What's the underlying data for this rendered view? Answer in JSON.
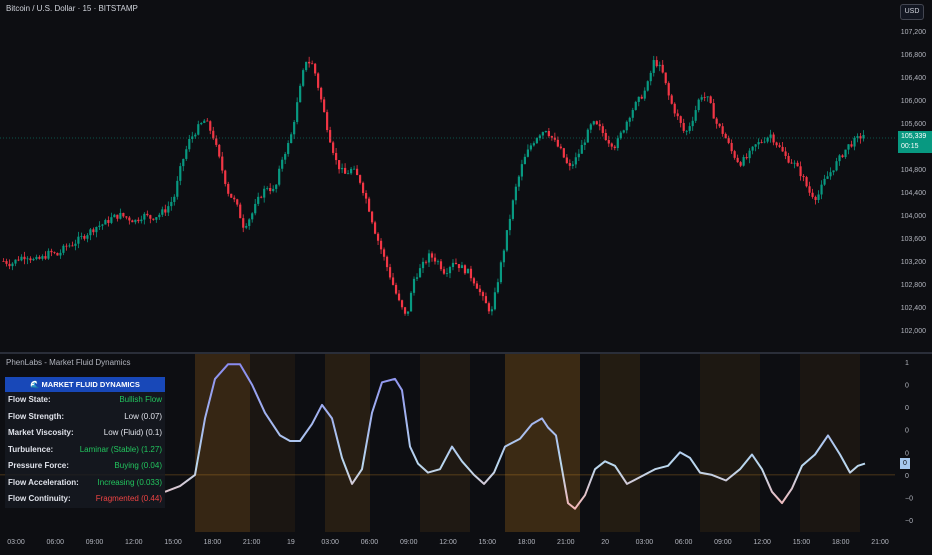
{
  "header": {
    "symbol_title": "Bitcoin / U.S. Dollar · 15 · BITSTAMP",
    "currency": "USD"
  },
  "price_axis": {
    "ticks": [
      "107,200",
      "106,800",
      "106,400",
      "106,000",
      "105,600",
      "104,800",
      "104,400",
      "104,000",
      "103,600",
      "103,200",
      "102,800",
      "102,400",
      "102,000"
    ],
    "tick_values": [
      107200,
      106800,
      106400,
      106000,
      105600,
      104800,
      104400,
      104000,
      103600,
      103200,
      102800,
      102400,
      102000
    ],
    "current_price": "105,339",
    "current_price_value": 105339,
    "countdown": "00:15"
  },
  "indicator": {
    "title": "PhenLabs - Market Fluid Dynamics",
    "axis_ticks": [
      "1",
      "0",
      "0",
      "0",
      "0",
      "0",
      "−0",
      "−0"
    ],
    "axis_tick_values": [
      1,
      0.8,
      0.6,
      0.4,
      0.2,
      0,
      -0.2,
      -0.4
    ],
    "current_value": "0",
    "table": {
      "header": "🌊 MARKET FLUID DYNAMICS",
      "rows": [
        {
          "label": "Flow State:",
          "value": "Bullish Flow",
          "color": "#22c55e"
        },
        {
          "label": "Flow Strength:",
          "value": "Low (0.07)",
          "color": "#e0e3eb"
        },
        {
          "label": "Market Viscosity:",
          "value": "Low (Fluid) (0.1)",
          "color": "#e0e3eb"
        },
        {
          "label": "Turbulence:",
          "value": "Laminar (Stable) (1.27)",
          "color": "#22c55e"
        },
        {
          "label": "Pressure Force:",
          "value": "Buying (0.04)",
          "color": "#22c55e"
        },
        {
          "label": "Flow Acceleration:",
          "value": "Increasing (0.033)",
          "color": "#22c55e"
        },
        {
          "label": "Flow Continuity:",
          "value": "Fragmented (0.44)",
          "color": "#ef4444"
        }
      ]
    }
  },
  "time_axis": {
    "labels": [
      "03:00",
      "06:00",
      "09:00",
      "12:00",
      "15:00",
      "18:00",
      "21:00",
      "19",
      "03:00",
      "06:00",
      "09:00",
      "12:00",
      "15:00",
      "18:00",
      "21:00",
      "20",
      "03:00",
      "06:00",
      "09:00",
      "12:00",
      "15:00",
      "18:00",
      "21:00"
    ]
  },
  "colors": {
    "up": "#089981",
    "down": "#f23645",
    "background": "#0d0e12",
    "accent": "#1848b8"
  },
  "chart_data": {
    "type": "candlestick",
    "price_path": [
      103200,
      103150,
      103250,
      103300,
      103200,
      103250,
      103350,
      103300,
      103450,
      103500,
      103600,
      103700,
      103800,
      103850,
      103950,
      104000,
      103950,
      103900,
      104000,
      103950,
      104000,
      104100,
      104300,
      104900,
      105300,
      105500,
      105650,
      105400,
      104900,
      104400,
      104200,
      103800,
      104000,
      104300,
      104500,
      104400,
      105000,
      105300,
      106000,
      106700,
      106600,
      106000,
      105400,
      104900,
      104700,
      104800,
      104600,
      104200,
      103700,
      103300,
      102900,
      102500,
      102200,
      102900,
      103100,
      103300,
      103200,
      103000,
      103200,
      103100,
      103000,
      102800,
      102500,
      102300,
      103000,
      103700,
      104400,
      104900,
      105200,
      105400,
      105500,
      105300,
      105100,
      104800,
      105000,
      105300,
      105600,
      105500,
      105300,
      105200,
      105500,
      105800,
      106000,
      106200,
      106700,
      106500,
      106000,
      105700,
      105400,
      105700,
      106100,
      106000,
      105600,
      105400,
      105100,
      104900,
      105000,
      105200,
      105300,
      105400,
      105200,
      105000,
      104900,
      104700,
      104400,
      104300,
      104600,
      104800,
      105000,
      105200,
      105300,
      105400
    ]
  }
}
